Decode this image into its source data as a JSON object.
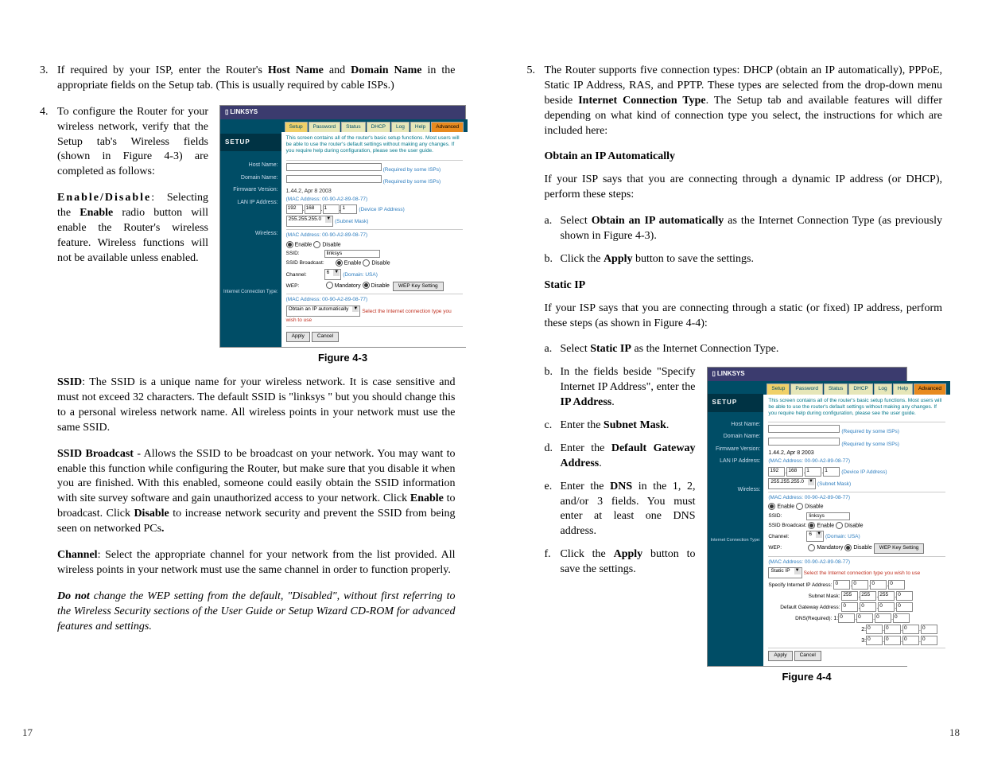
{
  "left": {
    "li3": {
      "n": "3.",
      "pre": "If required by your ISP, enter the Router's ",
      "b1": "Host Name",
      "mid": " and ",
      "b2": "Domain Name",
      "post": " in the appropriate fields on the Setup tab. (This is usually required by cable ISPs.)"
    },
    "li4": {
      "n": "4.",
      "text": "To configure the Router for your wireless network, verify that the Setup tab's Wireless fields (shown in Figure 4-3) are completed as follows:"
    },
    "enable": {
      "label": "Enable/Disable",
      "text": ": Selecting the ",
      "b": "Enable",
      "rest": " radio button will enable the Router's wireless feature. Wireless functions will not be available unless enabled."
    },
    "ssid": {
      "b": "SSID",
      "text": ": The SSID is a unique name for your wireless network.  It is case sensitive and must not exceed 32 characters.  The default SSID is \"linksys \" but you should change this to a personal wireless network name.  All wireless points in your network must use the same SSID."
    },
    "broadcast": {
      "b": "SSID Broadcast",
      "pre": " - Allows the SSID to be broadcast on your network. You may want to enable this function while configuring the Router, but make sure that you disable it when you are finished. With this enabled, someone could easily obtain the SSID information with site survey software and gain unauthorized access to your network. Click ",
      "b2": "Enable",
      "mid": " to broadcast. Click ",
      "b3": "Disable",
      "post": " to increase network security and prevent the SSID from being seen on networked PCs",
      "dot": "."
    },
    "channel": {
      "b": "Channel",
      "text": ": Select the appropriate channel for your network from the list provided.  All wireless points in your network must use the same channel in order to function properly."
    },
    "wep": {
      "b": "Do not",
      "text": " change the WEP setting from the default, \"Disabled\", without first referring to the Wireless Security sections of the User Guide or Setup Wizard CD-ROM for advanced features and settings."
    },
    "fig": "Figure 4-3",
    "pagenum": "17"
  },
  "right": {
    "li5": {
      "n": "5.",
      "pre": "The Router supports five connection types: DHCP (obtain an IP automatically), PPPoE, Static IP Address, RAS, and PPTP. These types are selected from the drop-down menu beside ",
      "b": "Internet Connection Type",
      "post": ". The Setup tab and available features will differ depending on what kind of connection type you select, the instructions for which are included here:"
    },
    "obtain": {
      "h": "Obtain an IP Automatically",
      "p": "If your ISP says that you are connecting through a dynamic IP address (or DHCP), perform these steps:"
    },
    "oa": {
      "n": "a.",
      "pre": "Select ",
      "b": "Obtain an IP automatically",
      "post": " as the Internet Connection Type (as previously shown in Figure 4-3)."
    },
    "ob": {
      "n": "b.",
      "pre": "Click the ",
      "b": "Apply",
      "post": " button to save the settings."
    },
    "static": {
      "h": "Static IP",
      "p": "If your ISP says that you are connecting through a static (or fixed) IP address, perform these steps (as shown in Figure 4-4):"
    },
    "sa": {
      "n": "a.",
      "pre": "Select ",
      "b": "Static IP",
      "post": " as the Internet Connection Type."
    },
    "sb": {
      "n": "b.",
      "pre": "In the fields beside \"Specify Internet IP Address\", enter the ",
      "b": "IP Address",
      "post": "."
    },
    "sc": {
      "n": "c.",
      "pre": "Enter the ",
      "b": "Subnet Mask",
      "post": "."
    },
    "sd": {
      "n": "d.",
      "pre": "Enter the ",
      "b": "Default Gateway Address",
      "post": "."
    },
    "se": {
      "n": "e.",
      "pre": "Enter the ",
      "b": "DNS",
      "post": " in the 1, 2, and/or 3 fields. You must enter at least one DNS address."
    },
    "sf": {
      "n": "f.",
      "pre": "Click the ",
      "b": "Apply",
      "post": " button to save the settings."
    },
    "fig": "Figure 4-4",
    "pagenum": "18"
  },
  "shot": {
    "brand": "LINKSYS",
    "tabs": [
      "Setup",
      "Password",
      "Status",
      "DHCP",
      "Log",
      "Help"
    ],
    "adv": "Advanced",
    "setup": "SETUP",
    "desc": "This screen contains all of the router's basic setup functions. Most users will be able to use the router's default settings without making any changes. If you require help during configuration, please see the user guide.",
    "labels": {
      "host": "Host Name:",
      "domain": "Domain Name:",
      "fw": "Firmware Version:",
      "lan": "LAN IP Address:",
      "wl": "Wireless:",
      "ict": "Internet Connection Type:"
    },
    "hint_req": "(Required by some ISPs)",
    "fw_val": "1.44.2, Apr 8 2003",
    "mac1": "(MAC Address: 00-90-A2-89-08-77)",
    "devip": "(Device IP Address)",
    "subnet": "(Subnet Mask)",
    "subnet_val": "255.255.255.0",
    "ip1": "192",
    "ip2": "168",
    "ip3": "1",
    "ip4": "1",
    "enable": "Enable",
    "disable": "Disable",
    "ssid_l": "SSID:",
    "ssid_v": "linksys",
    "ssidb": "SSID Broadcast:",
    "chan": "Channel:",
    "chan_v": "6",
    "chan_dom": "(Domain: USA)",
    "wep": "WEP:",
    "mand": "Mandatory",
    "wepbtn": "WEP Key Setting",
    "ict_sel": "Obtain an IP automatically",
    "ict_red": "Select the Internet connection type you wish to use",
    "apply": "Apply",
    "cancel": "Cancel",
    "static_sel": "Static IP",
    "spec": "Specify Internet IP Address:",
    "sm": "Subnet Mask:",
    "dga": "Default Gateway Address:",
    "dns": "DNS(Required):",
    "s_ip": "0",
    "s_sm1": "255",
    "s_sm4": "0",
    "dns1": "1:",
    "dns2": "2:",
    "dns3": "3:"
  }
}
